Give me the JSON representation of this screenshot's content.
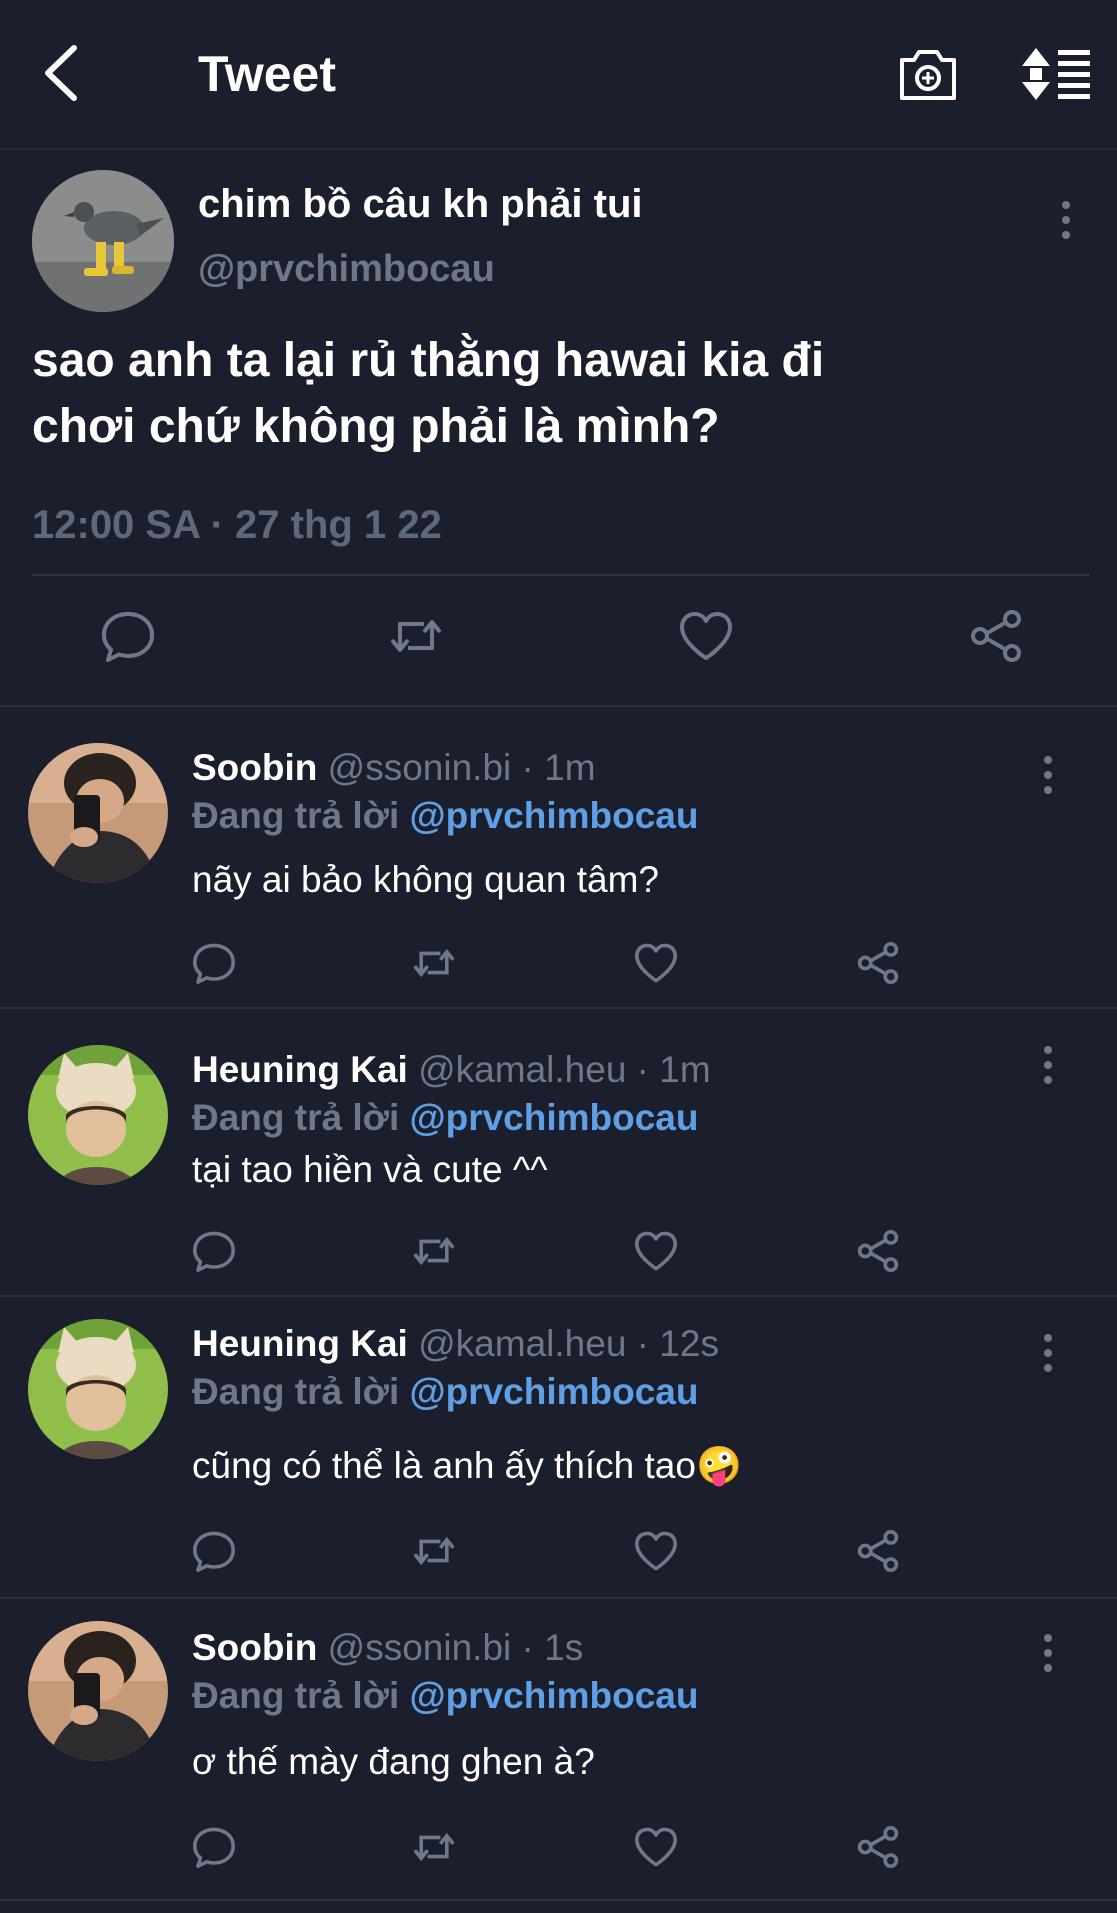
{
  "header": {
    "title": "Tweet",
    "back_icon": "chevron-left-icon",
    "camera_icon": "camera-plus-icon",
    "sort_icon": "sort-icon"
  },
  "main_tweet": {
    "author_name": "chim bồ câu kh phải tui",
    "author_handle": "@prvchimbocau",
    "text_line1": "sao anh ta lại rủ thằng hawai kia đi",
    "text_line2": "chơi chứ không phải là mình?",
    "timestamp": "12:00 SA · 27 thg 1 22"
  },
  "replies": [
    {
      "name": "Soobin",
      "handle": "@ssonin.bi",
      "sep": " · ",
      "time": "1m",
      "reply_label": "Đang trả lời ",
      "reply_handle": "@prvchimbocau",
      "text": "nãy ai bảo không quan tâm?"
    },
    {
      "name": "Heuning Kai",
      "handle": "@kamal.heu",
      "sep": " · ",
      "time": "1m",
      "reply_label": "Đang trả lời ",
      "reply_handle": "@prvchimbocau",
      "text": "tại tao hiền và cute ^^"
    },
    {
      "name": "Heuning Kai",
      "handle": "@kamal.heu",
      "sep": " · ",
      "time": "12s",
      "reply_label": "Đang trả lời ",
      "reply_handle": "@prvchimbocau",
      "text": "cũng có thể là anh ấy thích tao🤪"
    },
    {
      "name": "Soobin",
      "handle": "@ssonin.bi",
      "sep": " · ",
      "time": "1s",
      "reply_label": "Đang trả lời ",
      "reply_handle": "@prvchimbocau",
      "text": "ơ thế mày đang ghen à?"
    }
  ],
  "colors": {
    "background": "#1b1f2d",
    "mention": "#5fa0e4",
    "muted": "#6f7888"
  }
}
